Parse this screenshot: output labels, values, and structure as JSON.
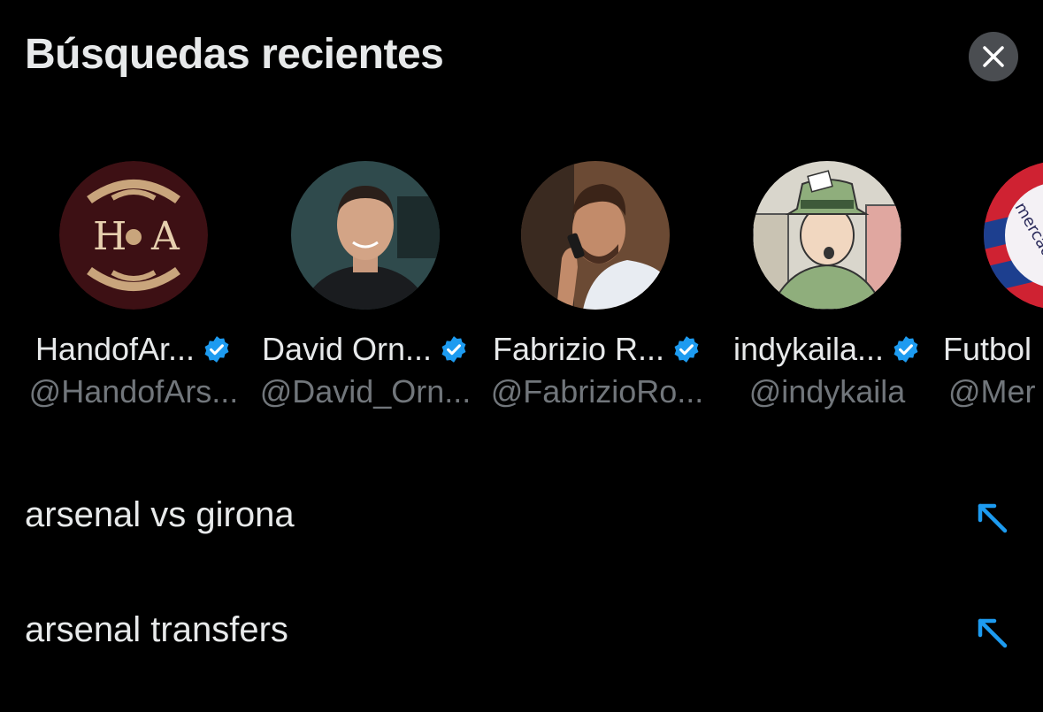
{
  "header": {
    "title": "Búsquedas recientes",
    "close_icon": "close-icon"
  },
  "accounts": [
    {
      "name": "HandofAr...",
      "handle": "@HandofArs...",
      "verified": true,
      "avatar_icon": "hoa-logo-avatar"
    },
    {
      "name": "David Orn...",
      "handle": "@David_Orn...",
      "verified": true,
      "avatar_icon": "person-photo-avatar"
    },
    {
      "name": "Fabrizio R...",
      "handle": "@FabrizioRo...",
      "verified": true,
      "avatar_icon": "person-on-phone-avatar"
    },
    {
      "name": "indykaila...",
      "handle": "@indykaila",
      "verified": true,
      "avatar_icon": "press-cartoon-avatar"
    },
    {
      "name": "Futbol",
      "handle": "@Mer",
      "verified": false,
      "avatar_icon": "mercado-logo-avatar"
    }
  ],
  "recent_searches": [
    {
      "query": "arsenal vs girona",
      "icon": "fill-search-arrow-icon"
    },
    {
      "query": "arsenal transfers",
      "icon": "fill-search-arrow-icon"
    }
  ],
  "colors": {
    "background": "#000000",
    "text_primary": "#e7e9ea",
    "text_secondary": "#71767b",
    "verified_blue": "#1d9bf0",
    "close_button_bg": "#4a4d51"
  }
}
